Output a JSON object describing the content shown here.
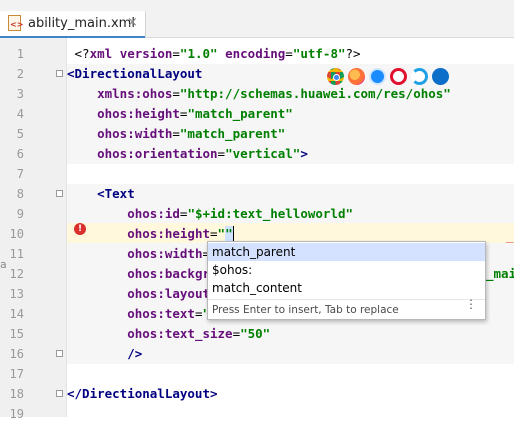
{
  "tab": {
    "icon_text": "<>",
    "filename": "ability_main.xml",
    "close": "×"
  },
  "gutter": {
    "line_numbers": [
      "1",
      "2",
      "3",
      "4",
      "5",
      "6",
      "7",
      "8",
      "9",
      "10",
      "11",
      "12",
      "13",
      "14",
      "15",
      "16",
      "17",
      "18",
      "19"
    ]
  },
  "code": {
    "l1": {
      "a": "<?",
      "b": "xml version",
      "c": "=",
      "d": "\"1.0\"",
      "e": " encoding",
      "f": "=",
      "g": "\"utf-8\"",
      "h": "?>"
    },
    "l2": {
      "a": "<DirectionalLayout"
    },
    "l3": {
      "a": "xmlns:ohos",
      "b": "=",
      "c": "\"http://schemas.huawei.com/res/ohos\""
    },
    "l4": {
      "a": "ohos:height",
      "b": "=",
      "c": "\"match_parent\""
    },
    "l5": {
      "a": "ohos:width",
      "b": "=",
      "c": "\"match_parent\""
    },
    "l6": {
      "a": "ohos:orientation",
      "b": "=",
      "c": "\"vertical\"",
      "d": ">"
    },
    "l8": {
      "a": "<Text"
    },
    "l9": {
      "a": "ohos:id",
      "b": "=",
      "c": "\"$+id:text_helloworld\""
    },
    "l10": {
      "a": "ohos:height",
      "b": "=",
      "c": "\"",
      "d": "\""
    },
    "l11": {
      "a": "ohos:width",
      "b": "=",
      "c": "\""
    },
    "l12": {
      "a": "ohos:backgro"
    },
    "l13": {
      "a": "ohos:layout_"
    },
    "l14": {
      "a": "ohos:text",
      "b": "=",
      "c": "\"$"
    },
    "l15": {
      "a": "ohos:text_size",
      "b": "=",
      "c": "\"50\""
    },
    "l16": {
      "a": "/>"
    },
    "l18": {
      "a": "</DirectionalLayout",
      "b": ">"
    }
  },
  "fragments": {
    "l12_right": "_mai",
    "l10_right": "_"
  },
  "completion": {
    "items": [
      "match_parent",
      "$ohos:",
      "match_content"
    ],
    "selected_index": 0,
    "hint": "Press Enter to insert, Tab to replace",
    "more": "⋮"
  },
  "browser_icons": [
    "chrome-icon",
    "firefox-icon",
    "safari-icon",
    "opera-icon",
    "ie-icon",
    "edge-icon"
  ],
  "colors": {
    "tag": "#000080",
    "attribute": "#660e7a",
    "value": "#008000",
    "selection": "#d4e2ff",
    "error": "#d9302b"
  },
  "left_strip": "a"
}
